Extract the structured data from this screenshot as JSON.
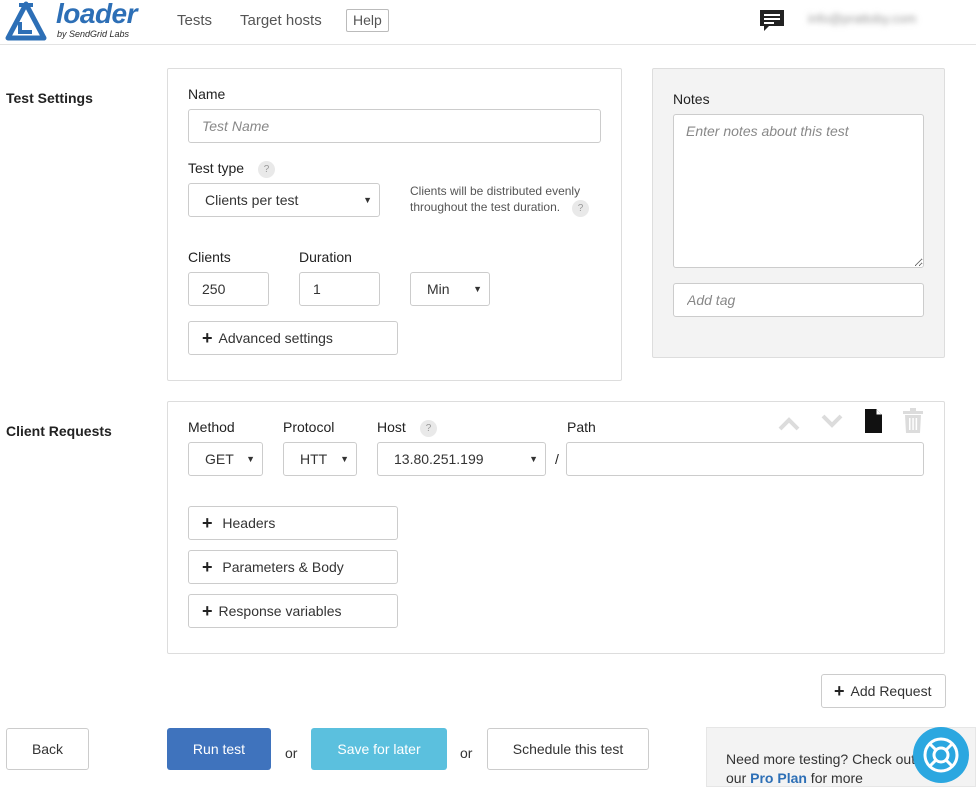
{
  "header": {
    "logo_text": "loader",
    "logo_sub": "by SendGrid Labs",
    "nav": [
      "Tests",
      "Target hosts"
    ],
    "help_label": "Help",
    "user_email": "info@prattoby.com"
  },
  "test_settings": {
    "section_label": "Test Settings",
    "name_label": "Name",
    "name_placeholder": "Test Name",
    "test_type_label": "Test type",
    "test_type_value": "Clients per test",
    "test_type_hint": "Clients will be distributed evenly throughout the test duration.",
    "clients_label": "Clients",
    "clients_value": "250",
    "duration_label": "Duration",
    "duration_value": "1",
    "duration_unit": "Min",
    "advanced_label": "Advanced settings",
    "help_mark": "?"
  },
  "notes": {
    "label": "Notes",
    "placeholder": "Enter notes about this test",
    "tag_placeholder": "Add tag"
  },
  "client_requests": {
    "section_label": "Client Requests",
    "method_label": "Method",
    "method_value": "GET",
    "protocol_label": "Protocol",
    "protocol_value": "HTT",
    "host_label": "Host",
    "host_value": "13.80.251.199",
    "path_label": "Path",
    "path_separator": "/",
    "path_value": "",
    "headers_label": "Headers",
    "params_label": "Parameters & Body",
    "response_vars_label": "Response variables"
  },
  "actions": {
    "add_request": "Add Request",
    "back": "Back",
    "run_test": "Run test",
    "or": "or",
    "save_later": "Save for later",
    "schedule": "Schedule this test"
  },
  "promo": {
    "text_before": "Need more testing? Check out our ",
    "link": "Pro Plan",
    "text_after": " for more"
  },
  "colors": {
    "brand": "#2d6fb6",
    "primary": "#3f73bd",
    "info": "#5bc0de",
    "support": "#2ba7e0"
  }
}
